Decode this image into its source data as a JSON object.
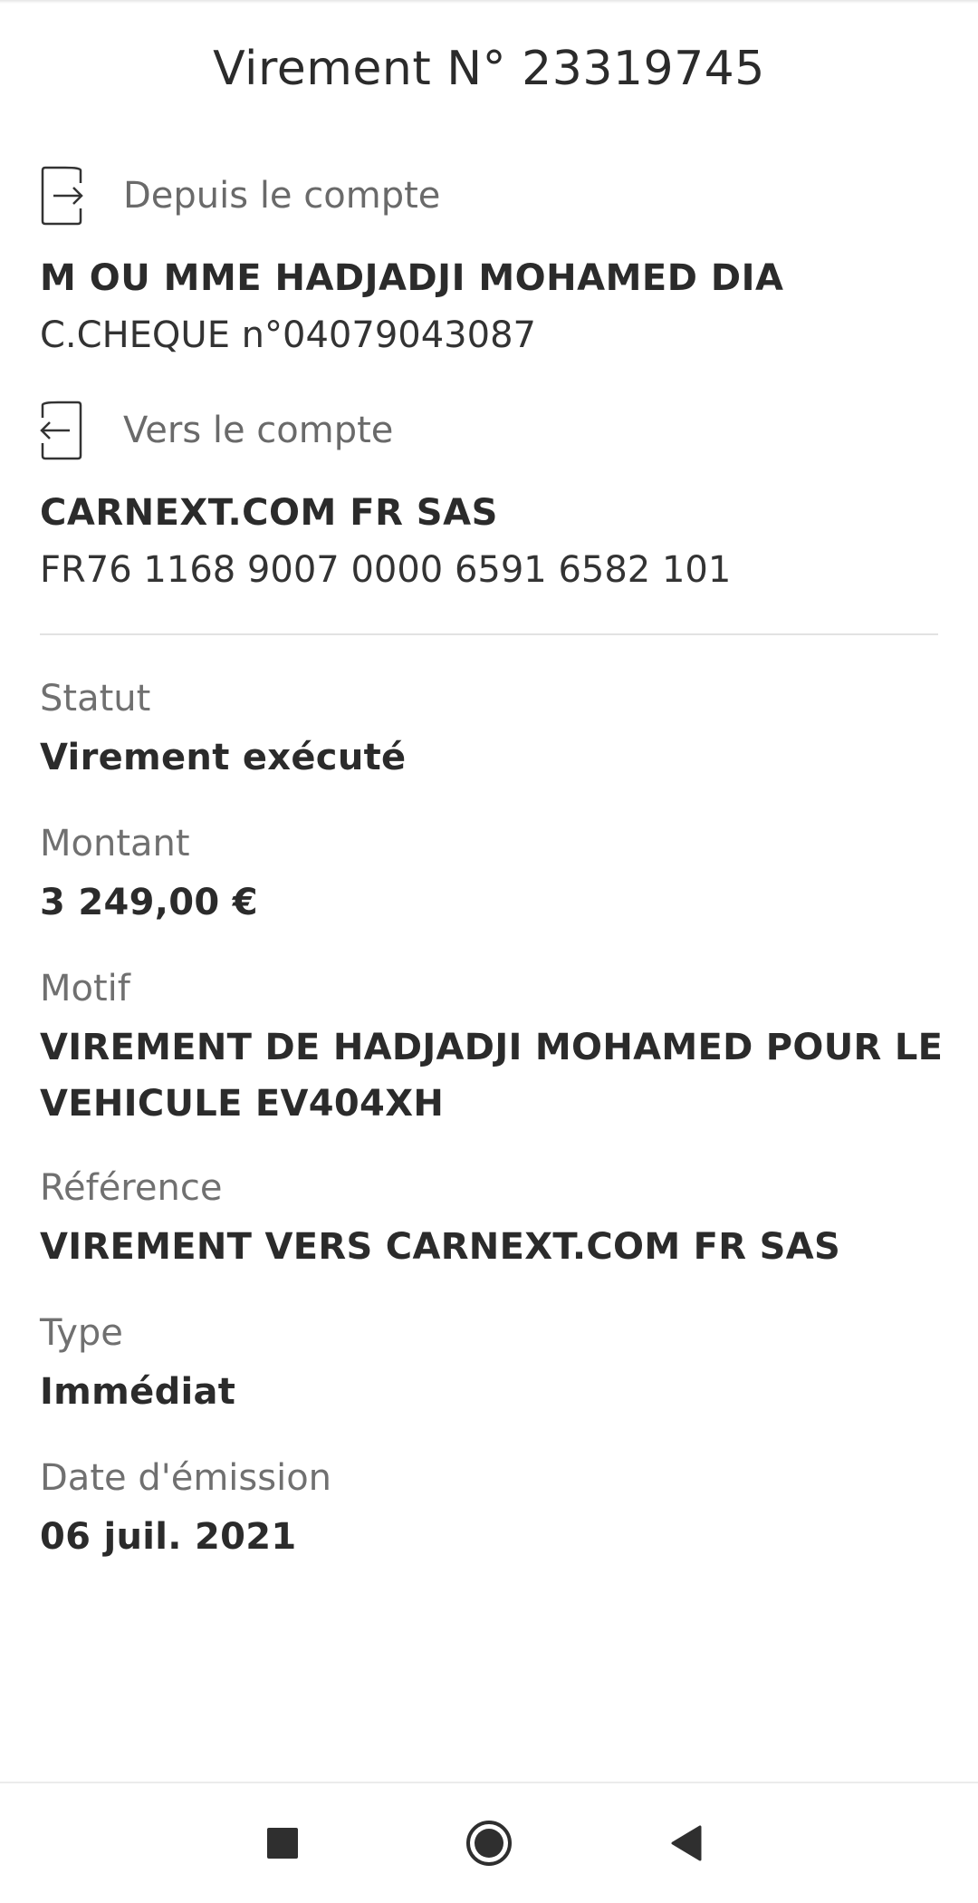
{
  "header": {
    "title": "Virement N° 23319745"
  },
  "from": {
    "heading": "Depuis le compte",
    "icon": "arrow-into-box-icon",
    "name": "M OU MME HADJADJI MOHAMED DIA",
    "account": "C.CHEQUE n°04079043087"
  },
  "to": {
    "heading": "Vers le compte",
    "icon": "arrow-out-of-box-icon",
    "name": "CARNEXT.COM FR SAS",
    "iban": "FR76 1168 9007 0000 6591 6582 101"
  },
  "details": {
    "status_label": "Statut",
    "status_value": "Virement exécuté",
    "amount_label": "Montant",
    "amount_value": "3 249,00 €",
    "reason_label": "Motif",
    "reason_value": "VIREMENT DE HADJADJI MOHAMED POUR LE VEHICULE EV404XH",
    "reference_label": "Référence",
    "reference_value": "VIREMENT VERS CARNEXT.COM FR SAS",
    "type_label": "Type",
    "type_value": "Immédiat",
    "date_label": "Date d'émission",
    "date_value": "06 juil. 2021"
  },
  "navbar": {
    "recents_icon": "square-icon",
    "home_icon": "circle-icon",
    "back_icon": "triangle-back-icon",
    "color": "#2f2f2f"
  }
}
